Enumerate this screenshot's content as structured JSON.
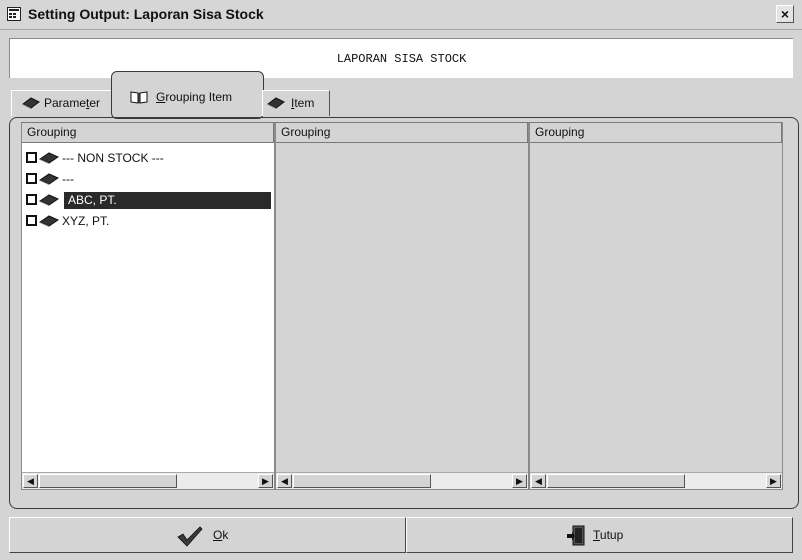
{
  "window": {
    "title": "Setting Output: Laporan Sisa Stock",
    "close_glyph": "×"
  },
  "banner": {
    "text": "LAPORAN SISA STOCK"
  },
  "tabs": [
    {
      "label": "Parameter",
      "mnemonic_index": 6,
      "icon": "book-icon"
    },
    {
      "label": "Grouping Item",
      "mnemonic_index": 0,
      "icon": "open-book-icon",
      "active": true
    },
    {
      "label": "Item",
      "mnemonic_index": 0,
      "icon": "book-icon"
    }
  ],
  "columns": [
    {
      "header": "Grouping",
      "items": [
        {
          "text": "--- NON STOCK ---",
          "checked": false,
          "selected": false
        },
        {
          "text": "---",
          "checked": false,
          "selected": false
        },
        {
          "text": "ABC, PT.",
          "checked": false,
          "selected": true
        },
        {
          "text": "XYZ, PT.",
          "checked": false,
          "selected": false
        }
      ]
    },
    {
      "header": "Grouping",
      "items": []
    },
    {
      "header": "Grouping",
      "items": []
    }
  ],
  "buttons": {
    "ok_label": "Ok",
    "close_label": "Tutup"
  },
  "colors": {
    "selection_bg": "#2a2a2a",
    "window_bg": "#d4d4d4",
    "list_bg": "#ffffff"
  }
}
